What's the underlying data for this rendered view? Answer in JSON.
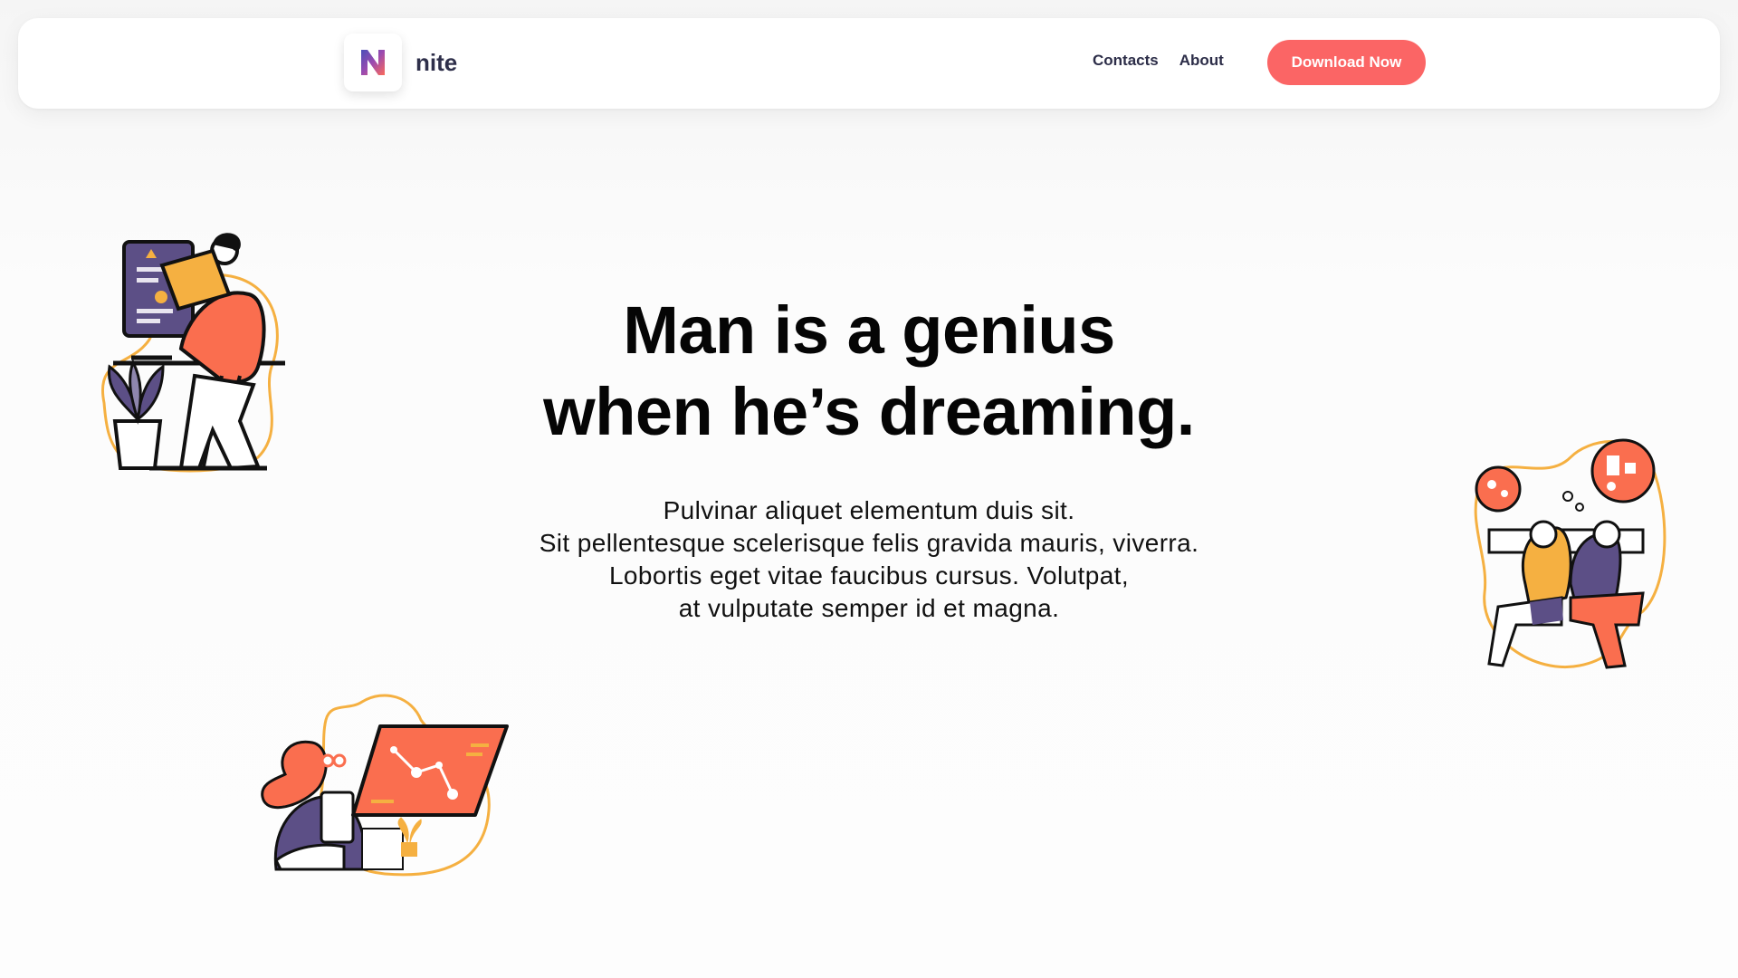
{
  "brand": {
    "name": "nite",
    "logo_letter": "N"
  },
  "nav": {
    "links": [
      {
        "label": "Contacts"
      },
      {
        "label": "About"
      }
    ],
    "cta_label": "Download Now"
  },
  "hero": {
    "title_lines": [
      "Man is a genius",
      "when he’s dreaming."
    ],
    "text_lines": [
      "Pulvinar aliquet elementum duis sit.",
      "Sit pellentesque scelerisque felis gravida mauris, viverra.",
      "Lobortis eget vitae faucibus cursus. Volutpat,",
      "at vulputate semper id et magna."
    ]
  },
  "illustrations": [
    {
      "name": "person-at-monitor-illustration"
    },
    {
      "name": "two-people-thinking-illustration"
    },
    {
      "name": "woman-with-tablet-chart-illustration"
    }
  ],
  "colors": {
    "accent": "#fb6565",
    "dark_navy": "#2e2f4a",
    "purple": "#5c4f86",
    "orange": "#f5b041",
    "coral": "#fa6e4f"
  }
}
